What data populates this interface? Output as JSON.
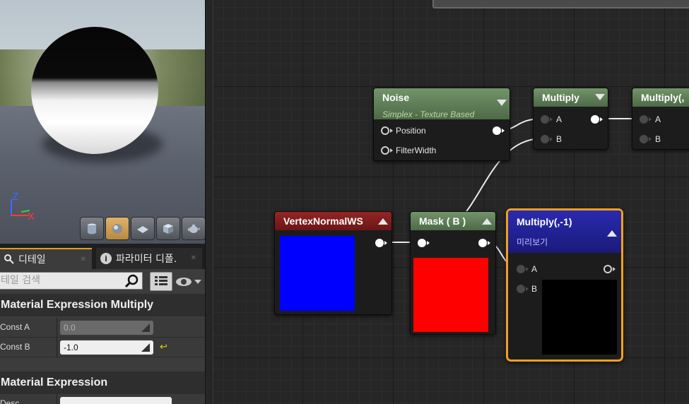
{
  "viewport": {
    "axis_z": "Z",
    "axis_x": "X",
    "buttons": [
      "cylinder-icon",
      "sphere-icon",
      "plane-icon",
      "cube-icon",
      "teapot-icon"
    ]
  },
  "details_panel": {
    "tab_details": "디테일",
    "tab_parameters": "파라미터 디폴.",
    "search_placeholder": "테일 검색",
    "section_multiply": "Material Expression Multiply",
    "section_expression": "Material Expression",
    "const_a_label": "Const A",
    "const_a_value": "0.0",
    "const_b_label": "Const B",
    "const_b_value": "-1.0",
    "desc_label": "Desc"
  },
  "graph": {
    "noise": {
      "title": "Noise",
      "subtitle": "Simplex - Texture Based",
      "pin_position": "Position",
      "pin_filterwidth": "FilterWidth"
    },
    "multiply1": {
      "title": "Multiply",
      "pin_a": "A",
      "pin_b": "B"
    },
    "multiply2": {
      "title": "Multiply(,",
      "pin_a": "A",
      "pin_b": "B"
    },
    "vertexnormal": {
      "title": "VertexNormalWS",
      "preview_color": "#0000ff"
    },
    "mask": {
      "title": "Mask ( B )",
      "preview_color": "#ff0000"
    },
    "multiply_neg": {
      "title": "Multiply(,-1)",
      "subtitle": "미리보기",
      "pin_a": "A",
      "pin_b": "B",
      "preview_color": "#000000",
      "selection_color": "#f0a020"
    }
  }
}
